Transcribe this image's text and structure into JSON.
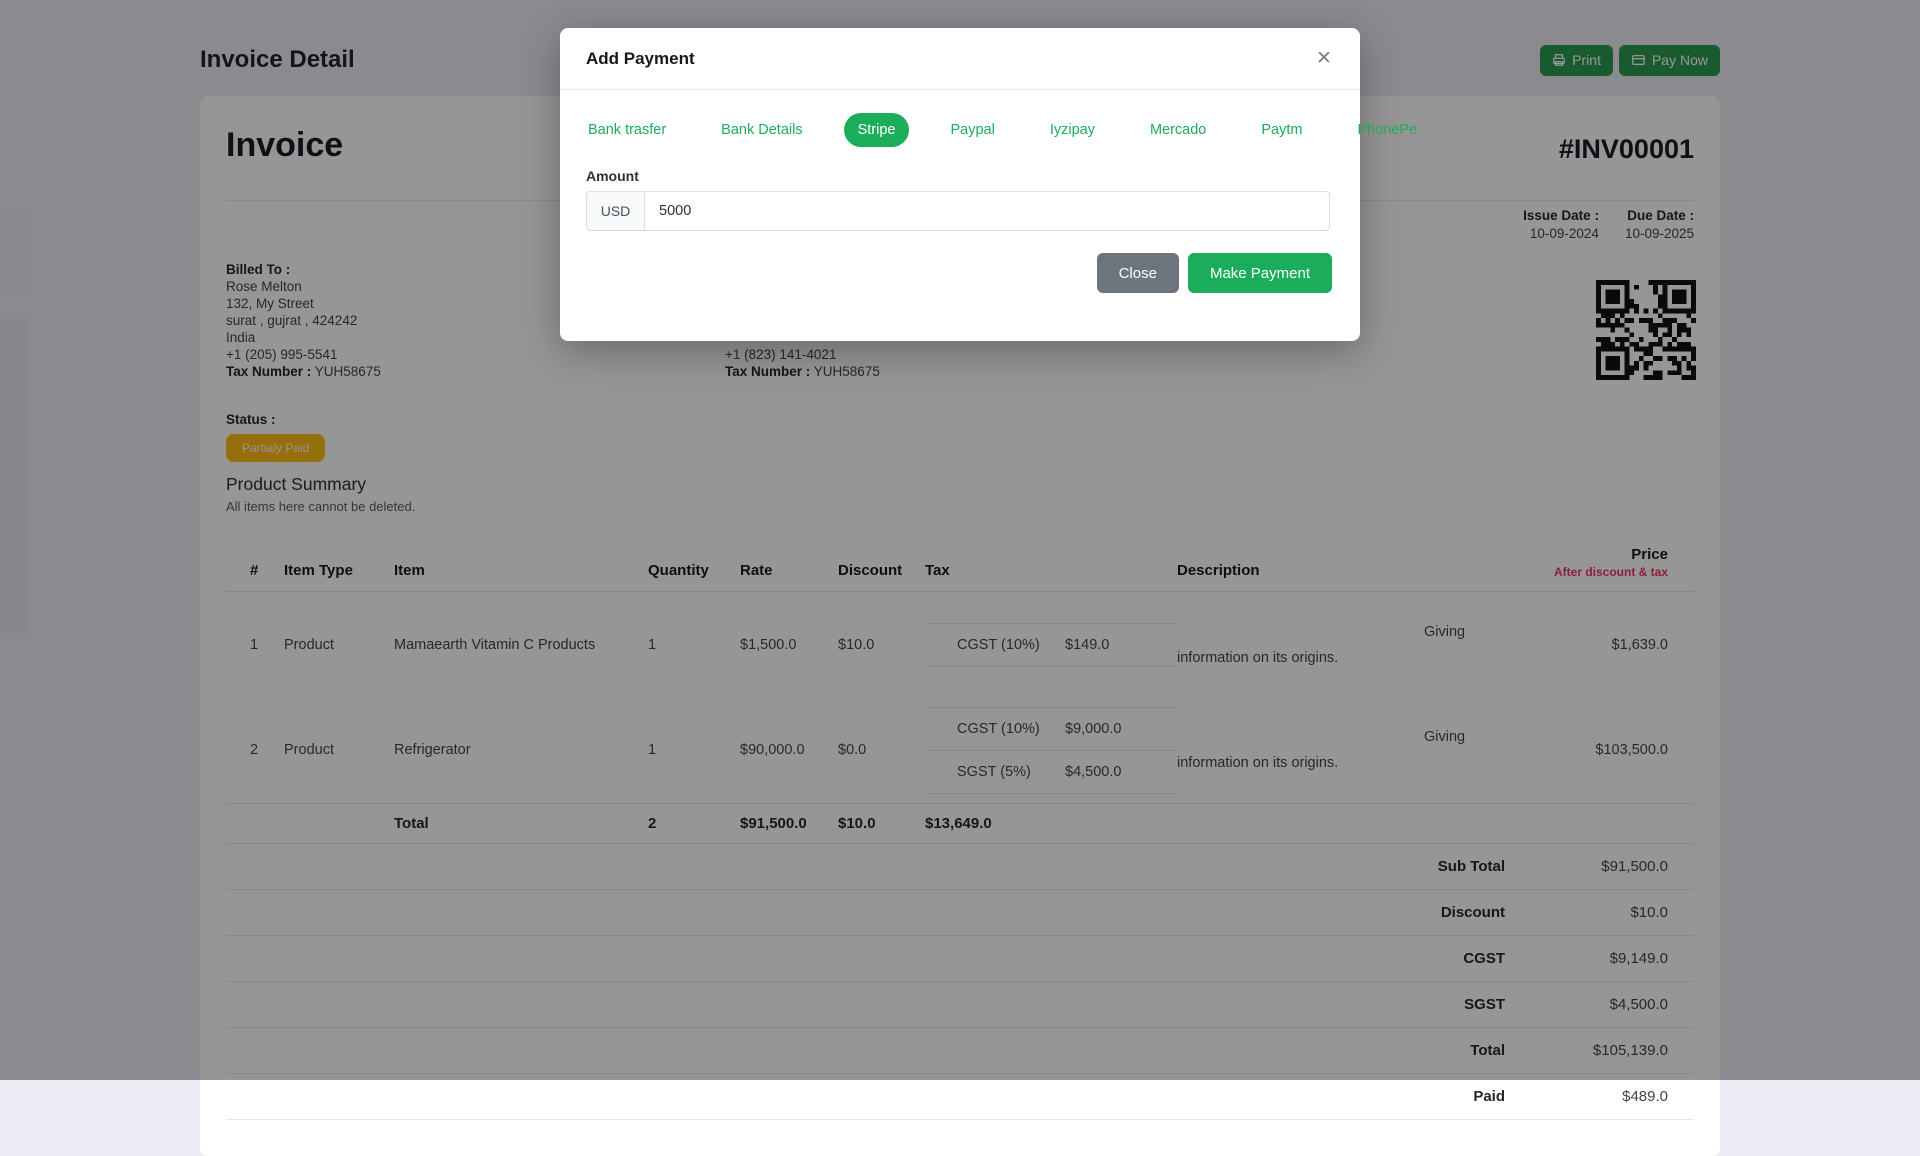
{
  "topbar": {
    "title": "Invoice Detail",
    "print_label": "Print",
    "pay_now_label": "Pay Now"
  },
  "invoice": {
    "title": "Invoice",
    "number": "#INV00001",
    "issue_date_label": "Issue Date :",
    "issue_date": "10-09-2024",
    "due_date_label": "Due Date :",
    "due_date": "10-09-2025",
    "billed_to": {
      "label": "Billed To :",
      "name": "Rose Melton",
      "street": "132, My Street",
      "city": "surat , gujrat , 424242",
      "country": "India",
      "phone": "+1 (205) 995-5541",
      "tax_label": "Tax Number :",
      "tax_value": "YUH58675"
    },
    "shipped_visible": {
      "phone": "+1 (823) 141-4021",
      "tax_label": "Tax Number :",
      "tax_value": "YUH58675"
    },
    "status_label": "Status :",
    "status_badge": "Partialy Paid"
  },
  "product_summary": {
    "title": "Product Summary",
    "subtitle": "All items here cannot be deleted."
  },
  "table": {
    "headers": {
      "num": "#",
      "item_type": "Item Type",
      "item": "Item",
      "quantity": "Quantity",
      "rate": "Rate",
      "discount": "Discount",
      "tax": "Tax",
      "description": "Description",
      "price": "Price",
      "price_sub": "After discount & tax"
    },
    "rows": [
      {
        "num": "1",
        "item_type": "Product",
        "item": "Mamaearth Vitamin C Products",
        "quantity": "1",
        "rate": "$1,500.0",
        "discount": "$10.0",
        "taxes": [
          {
            "label": "CGST (10%)",
            "amount": "$149.0"
          }
        ],
        "description_lines": [
          "Giving",
          "information on its origins."
        ],
        "price": "$1,639.0"
      },
      {
        "num": "2",
        "item_type": "Product",
        "item": "Refrigerator",
        "quantity": "1",
        "rate": "$90,000.0",
        "discount": "$0.0",
        "taxes": [
          {
            "label": "CGST (10%)",
            "amount": "$9,000.0"
          },
          {
            "label": "SGST (5%)",
            "amount": "$4,500.0"
          }
        ],
        "description_lines": [
          "Giving",
          "information on its origins."
        ],
        "price": "$103,500.0"
      }
    ],
    "total_row": {
      "label": "Total",
      "quantity": "2",
      "rate": "$91,500.0",
      "discount": "$10.0",
      "tax": "$13,649.0"
    },
    "summary": [
      {
        "label": "Sub Total",
        "value": "$91,500.0"
      },
      {
        "label": "Discount",
        "value": "$10.0"
      },
      {
        "label": "CGST",
        "value": "$9,149.0"
      },
      {
        "label": "SGST",
        "value": "$4,500.0"
      },
      {
        "label": "Total",
        "value": "$105,139.0"
      },
      {
        "label": "Paid",
        "value": "$489.0"
      }
    ]
  },
  "modal": {
    "title": "Add Payment",
    "close_icon": "✕",
    "tabs": [
      {
        "label": "Bank trasfer"
      },
      {
        "label": "Bank Details"
      },
      {
        "label": "Stripe"
      },
      {
        "label": "Paypal"
      },
      {
        "label": "Iyzipay"
      },
      {
        "label": "Mercado"
      },
      {
        "label": "Paytm"
      },
      {
        "label": "PhonePe"
      }
    ],
    "amount_label": "Amount",
    "currency": "USD",
    "amount_value": "5000",
    "close_label": "Close",
    "make_payment_label": "Make Payment"
  },
  "colors": {
    "accent_green": "#1cad5a",
    "button_green": "#2b9b51",
    "warning_badge": "#ffbb16",
    "price_sub_red": "#f13562"
  }
}
